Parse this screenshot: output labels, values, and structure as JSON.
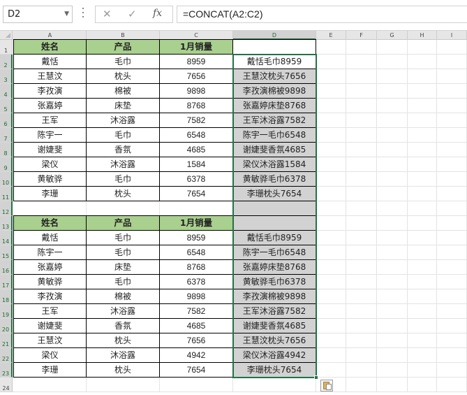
{
  "name_box": "D2",
  "formula": "=CONCAT(A2:C2)",
  "columns": [
    "A",
    "B",
    "C",
    "D",
    "E",
    "F",
    "G",
    "H",
    "I"
  ],
  "rows": [
    "1",
    "2",
    "3",
    "4",
    "5",
    "6",
    "7",
    "8",
    "9",
    "10",
    "11",
    "12",
    "13",
    "14",
    "15",
    "16",
    "17",
    "18",
    "19",
    "20",
    "21",
    "22",
    "23",
    "24"
  ],
  "table1": {
    "headers": [
      "姓名",
      "产品",
      "1月销量"
    ],
    "rows": [
      [
        "戴恬",
        "毛巾",
        "8959"
      ],
      [
        "王慧汶",
        "枕头",
        "7656"
      ],
      [
        "李孜演",
        "棉被",
        "9898"
      ],
      [
        "张嘉婷",
        "床垫",
        "8768"
      ],
      [
        "王军",
        "沐浴露",
        "7582"
      ],
      [
        "陈宇一",
        "毛巾",
        "6548"
      ],
      [
        "谢婕斐",
        "香氛",
        "4685"
      ],
      [
        "梁仪",
        "沐浴露",
        "1584"
      ],
      [
        "黄敏骅",
        "毛巾",
        "6378"
      ],
      [
        "李珊",
        "枕头",
        "7654"
      ]
    ],
    "d_values": [
      "戴恬毛巾8959",
      "王慧汶枕头7656",
      "李孜演棉被9898",
      "张嘉婷床垫8768",
      "王军沐浴露7582",
      "陈宇一毛巾6548",
      "谢婕斐香氛4685",
      "梁仪沐浴露1584",
      "黄敏骅毛巾6378",
      "李珊枕头7654"
    ]
  },
  "table2": {
    "headers": [
      "姓名",
      "产品",
      "1月销量"
    ],
    "rows": [
      [
        "戴恬",
        "毛巾",
        "8959"
      ],
      [
        "陈宇一",
        "毛巾",
        "6548"
      ],
      [
        "张嘉婷",
        "床垫",
        "8768"
      ],
      [
        "黄敏骅",
        "毛巾",
        "6378"
      ],
      [
        "李孜演",
        "棉被",
        "9898"
      ],
      [
        "王军",
        "沐浴露",
        "7582"
      ],
      [
        "谢婕斐",
        "香氛",
        "4685"
      ],
      [
        "王慧汶",
        "枕头",
        "7656"
      ],
      [
        "梁仪",
        "沐浴露",
        "4942"
      ],
      [
        "李珊",
        "枕头",
        "7654"
      ]
    ],
    "d_values": [
      "戴恬毛巾8959",
      "陈宇一毛巾6548",
      "张嘉婷床垫8768",
      "黄敏骅毛巾6378",
      "李孜演棉被9898",
      "王军沐浴露7582",
      "谢婕斐香氛4685",
      "王慧汶枕头7656",
      "梁仪沐浴露4942",
      "李珊枕头7654"
    ]
  },
  "colors": {
    "header_fill": "#a9d08e",
    "selection_border": "#217346",
    "selection_fill": "#d2d2d2"
  },
  "icons": [
    "cancel-icon",
    "enter-icon",
    "insert-function-icon",
    "paste-options-icon"
  ]
}
